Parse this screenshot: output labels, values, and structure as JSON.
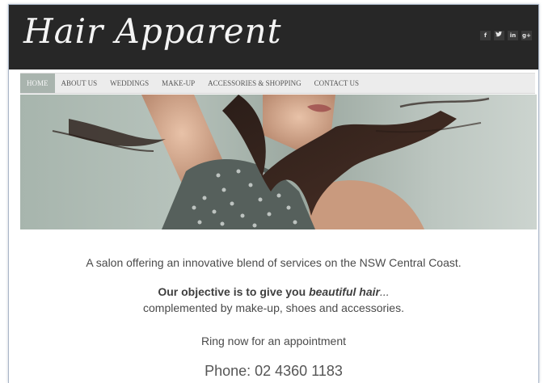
{
  "site": {
    "logo_text": "Hair Apparent",
    "social": [
      "f",
      "t",
      "in",
      "g+"
    ]
  },
  "nav": {
    "items": [
      "HOME",
      "ABOUT US",
      "WEDDINGS",
      "MAKE-UP",
      "ACCESSORIES & SHOPPING",
      "CONTACT US"
    ],
    "active": "HOME"
  },
  "hero": {
    "icon": "model-hair-photo"
  },
  "content": {
    "tagline": "A salon offering an innovative blend of services on the NSW Central Coast.",
    "objective_lead": "Our objective is to give you ",
    "objective_emph": "beautiful hair",
    "objective_trail": "...",
    "objective_line2": "complemented by make-up, shoes and accessories.",
    "ring": "Ring now for an appointment",
    "phone": "Phone: 02 4360 1183"
  },
  "colors": {
    "header_bg": "#272727",
    "nav_bg": "#ececec",
    "nav_active": "#a9b4ae",
    "text": "#4a4a4a"
  }
}
